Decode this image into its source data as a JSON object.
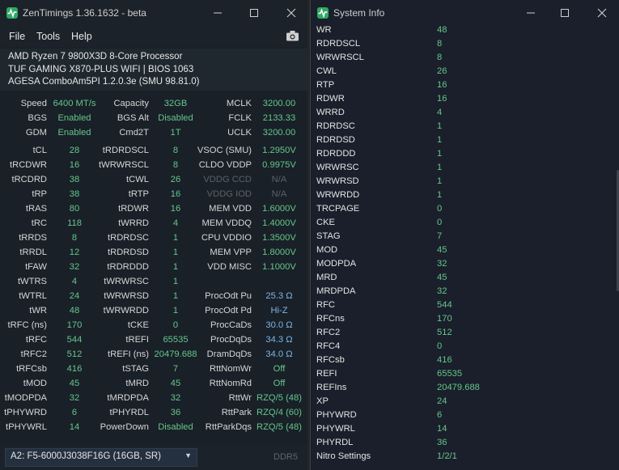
{
  "zentimings": {
    "title": "ZenTimings 1.36.1632 - beta",
    "menu": [
      "File",
      "Tools",
      "Help"
    ],
    "info": [
      "AMD Ryzen 7 9800X3D 8-Core Processor",
      "TUF GAMING X870-PLUS WIFI | BIOS 1063",
      "AGESA ComboAm5PI 1.2.0.3e (SMU 98.81.0)"
    ],
    "rows": [
      [
        [
          "Speed",
          "6400 MT/s"
        ],
        [
          "Capacity",
          "32GB"
        ],
        [
          "MCLK",
          "3200.00"
        ]
      ],
      [
        [
          "BGS",
          "Enabled"
        ],
        [
          "BGS Alt",
          "Disabled"
        ],
        [
          "FCLK",
          "2133.33"
        ]
      ],
      [
        [
          "GDM",
          "Enabled"
        ],
        [
          "Cmd2T",
          "1T"
        ],
        [
          "UCLK",
          "3200.00"
        ]
      ],
      null,
      [
        [
          "tCL",
          "28"
        ],
        [
          "tRDRDSCL",
          "8"
        ],
        [
          "VSOC (SMU)",
          "1.2950V"
        ]
      ],
      [
        [
          "tRCDWR",
          "16"
        ],
        [
          "tWRWRSCL",
          "8"
        ],
        [
          "CLDO VDDP",
          "0.9975V"
        ]
      ],
      [
        [
          "tRCDRD",
          "38"
        ],
        [
          "tCWL",
          "26"
        ],
        [
          "VDDG CCD",
          "N/A"
        ]
      ],
      [
        [
          "tRP",
          "38"
        ],
        [
          "tRTP",
          "16"
        ],
        [
          "VDDG IOD",
          "N/A"
        ]
      ],
      [
        [
          "tRAS",
          "80"
        ],
        [
          "tRDWR",
          "16"
        ],
        [
          "MEM VDD",
          "1.6000V"
        ]
      ],
      [
        [
          "tRC",
          "118"
        ],
        [
          "tWRRD",
          "4"
        ],
        [
          "MEM VDDQ",
          "1.4000V"
        ]
      ],
      [
        [
          "tRRDS",
          "8"
        ],
        [
          "tRDRDSC",
          "1"
        ],
        [
          "CPU VDDIO",
          "1.3500V"
        ]
      ],
      [
        [
          "tRRDL",
          "12"
        ],
        [
          "tRDRDSD",
          "1"
        ],
        [
          "MEM VPP",
          "1.8000V"
        ]
      ],
      [
        [
          "tFAW",
          "32"
        ],
        [
          "tRDRDDD",
          "1"
        ],
        [
          "VDD MISC",
          "1.1000V"
        ]
      ],
      [
        [
          "tWTRS",
          "4"
        ],
        [
          "tWRWRSC",
          "1"
        ],
        [
          "",
          ""
        ]
      ],
      [
        [
          "tWTRL",
          "24"
        ],
        [
          "tWRWRSD",
          "1"
        ],
        [
          "ProcOdt Pu",
          "25.3 Ω"
        ]
      ],
      [
        [
          "tWR",
          "48"
        ],
        [
          "tWRWRDD",
          "1"
        ],
        [
          "ProcOdt Pd",
          "Hi-Z"
        ]
      ],
      [
        [
          "tRFC (ns)",
          "170"
        ],
        [
          "tCKE",
          "0"
        ],
        [
          "ProcCaDs",
          "30.0 Ω"
        ]
      ],
      [
        [
          "tRFC",
          "544"
        ],
        [
          "tREFI",
          "65535"
        ],
        [
          "ProcDqDs",
          "34.3 Ω"
        ]
      ],
      [
        [
          "tRFC2",
          "512"
        ],
        [
          "tREFI (ns)",
          "20479.688"
        ],
        [
          "DramDqDs",
          "34.0 Ω"
        ]
      ],
      [
        [
          "tRFCsb",
          "416"
        ],
        [
          "tSTAG",
          "7"
        ],
        [
          "RttNomWr",
          "Off"
        ]
      ],
      [
        [
          "tMOD",
          "45"
        ],
        [
          "tMRD",
          "45"
        ],
        [
          "RttNomRd",
          "Off"
        ]
      ],
      [
        [
          "tMODPDA",
          "32"
        ],
        [
          "tMRDPDA",
          "32"
        ],
        [
          "RttWr",
          "RZQ/5 (48)"
        ]
      ],
      [
        [
          "tPHYWRD",
          "6"
        ],
        [
          "tPHYRDL",
          "36"
        ],
        [
          "RttPark",
          "RZQ/4 (60)"
        ]
      ],
      [
        [
          "tPHYWRL",
          "14"
        ],
        [
          "PowerDown",
          "Disabled"
        ],
        [
          "RttParkDqs",
          "RZQ/5 (48)"
        ]
      ]
    ],
    "dimm_selected": "A2: F5-6000J3038F16G (16GB, SR)",
    "ddr_type": "DDR5"
  },
  "sysinfo": {
    "title": "System Info",
    "rows": [
      [
        "WR",
        "48"
      ],
      [
        "RDRDSCL",
        "8"
      ],
      [
        "WRWRSCL",
        "8"
      ],
      [
        "CWL",
        "26"
      ],
      [
        "RTP",
        "16"
      ],
      [
        "RDWR",
        "16"
      ],
      [
        "WRRD",
        "4"
      ],
      [
        "RDRDSC",
        "1"
      ],
      [
        "RDRDSD",
        "1"
      ],
      [
        "RDRDDD",
        "1"
      ],
      [
        "WRWRSC",
        "1"
      ],
      [
        "WRWRSD",
        "1"
      ],
      [
        "WRWRDD",
        "1"
      ],
      [
        "TRCPAGE",
        "0"
      ],
      [
        "CKE",
        "0"
      ],
      [
        "STAG",
        "7"
      ],
      [
        "MOD",
        "45"
      ],
      [
        "MODPDA",
        "32"
      ],
      [
        "MRD",
        "45"
      ],
      [
        "MRDPDA",
        "32"
      ],
      [
        "RFC",
        "544"
      ],
      [
        "RFCns",
        "170"
      ],
      [
        "RFC2",
        "512"
      ],
      [
        "RFC4",
        "0"
      ],
      [
        "RFCsb",
        "416"
      ],
      [
        "REFI",
        "65535"
      ],
      [
        "REFIns",
        "20479.688"
      ],
      [
        "XP",
        "24"
      ],
      [
        "PHYWRD",
        "6"
      ],
      [
        "PHYWRL",
        "14"
      ],
      [
        "PHYRDL",
        "36"
      ],
      [
        "Nitro Settings",
        "1/2/1"
      ]
    ]
  },
  "colors": {
    "value_green": "#65c78a",
    "value_blue": "#7cb5e8",
    "disabled": "#5b6168"
  },
  "icons": [
    "zentimings-app-icon",
    "minimize-icon",
    "maximize-icon",
    "close-icon",
    "camera-icon",
    "chevron-down-icon"
  ]
}
